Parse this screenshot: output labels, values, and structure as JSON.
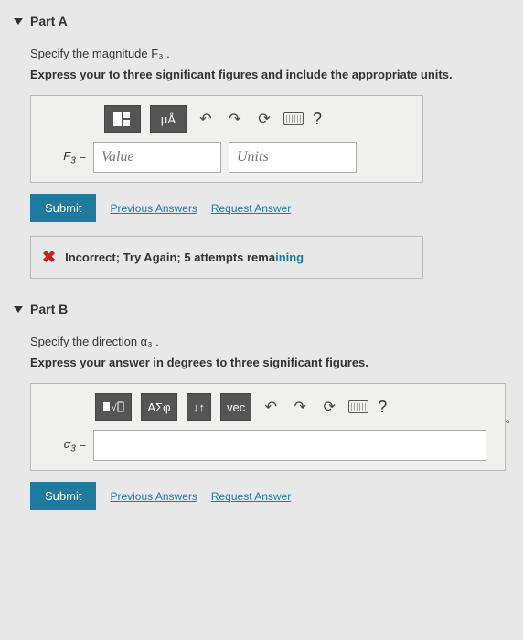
{
  "partA": {
    "title": "Part A",
    "specify": "Specify the magnitude F₃ .",
    "express": "Express your to three significant figures and include the appropriate units.",
    "toolbar": {
      "units_btn": "µÅ",
      "undo": "↶",
      "redo": "↷",
      "reset": "⟳",
      "help": "?"
    },
    "var_label": "F₃ =",
    "value_placeholder": "Value",
    "units_placeholder": "Units",
    "submit": "Submit",
    "prev_answers": "Previous Answers",
    "request_answer": "Request Answer",
    "feedback_x": "✖",
    "feedback_text": "Incorrect; Try Again; 5 attempts rema",
    "feedback_remaining": "ining"
  },
  "partB": {
    "title": "Part B",
    "specify": "Specify the direction α₃ .",
    "express": "Express your answer in degrees to three significant figures.",
    "toolbar": {
      "sym": "ΑΣφ",
      "updown": "↓↑",
      "vec": "vec",
      "undo": "↶",
      "redo": "↷",
      "reset": "⟳",
      "help": "?"
    },
    "var_label": "α₃ =",
    "degree_suffix": "∘",
    "submit": "Submit",
    "prev_answers": "Previous Answers",
    "request_answer": "Request Answer"
  }
}
